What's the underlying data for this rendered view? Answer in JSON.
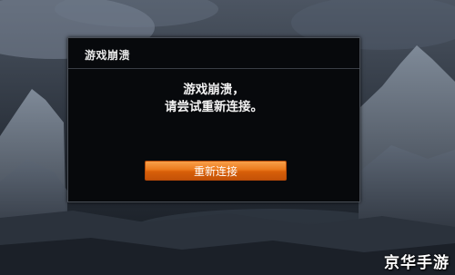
{
  "dialog": {
    "title": "游戏崩溃",
    "message_line1": "游戏崩溃，",
    "message_line2": "请尝试重新连接。",
    "reconnect_label": "重新连接"
  },
  "watermark": {
    "text": "京华手游"
  },
  "colors": {
    "button_orange": "#ec7a1c",
    "dialog_bg": "#07090c"
  }
}
